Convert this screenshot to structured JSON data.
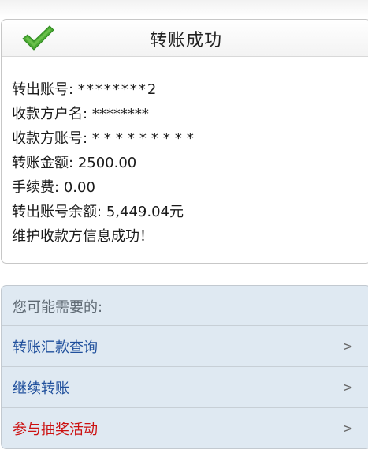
{
  "result": {
    "title": "转账成功",
    "details": [
      {
        "label": "转出账号:",
        "value": "********2"
      },
      {
        "label": "收款方户名:",
        "value": "********"
      },
      {
        "label": "收款方账号:",
        "value": "*********"
      },
      {
        "label": "转账金额:",
        "value": "2500.00"
      },
      {
        "label": "手续费:",
        "value": "0.00"
      },
      {
        "label": "转出账号余额:",
        "value": "5,449.04元"
      }
    ],
    "message": "维护收款方信息成功！"
  },
  "suggest": {
    "header": "您可能需要的:",
    "items": [
      {
        "label": "转账汇款查询",
        "arrow": ">",
        "color": "#1f4f9c"
      },
      {
        "label": "继续转账",
        "arrow": ">",
        "color": "#1f4f9c"
      },
      {
        "label": "参与抽奖活动",
        "arrow": ">",
        "color": "#cc1111"
      }
    ]
  },
  "colors": {
    "check": "#4aa832",
    "link": "#1f4f9c",
    "highlight": "#cc1111",
    "panel_bg": "#dfe9f2"
  },
  "icons": {
    "status": "check-mark-icon"
  }
}
